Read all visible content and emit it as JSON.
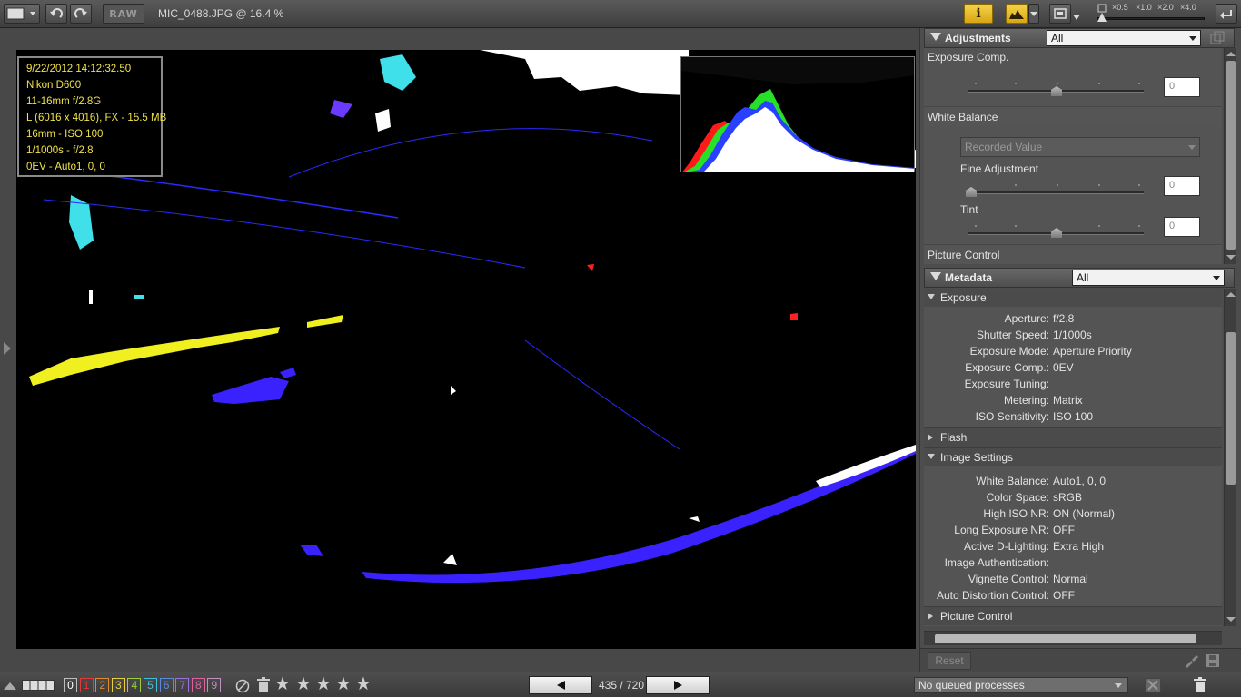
{
  "window": {
    "title": "MIC_0488.JPG @ 16.4 %"
  },
  "toolbar": {
    "raw_label": "RAW",
    "info_label": "i",
    "zoom_levels": [
      "×0.5",
      "×1.0",
      "×2.0",
      "×4.0"
    ]
  },
  "photo_info": {
    "lines": [
      "9/22/2012 14:12:32.50",
      "Nikon D600",
      "11-16mm f/2.8G",
      "L (6016 x 4016), FX - 15.5 MB",
      "16mm - ISO 100",
      "1/1000s - f/2.8",
      "0EV - Auto1, 0, 0"
    ]
  },
  "adjustments": {
    "title": "Adjustments",
    "filter": "All",
    "exposure_comp_label": "Exposure Comp.",
    "exposure_comp_value": "0",
    "white_balance_label": "White Balance",
    "white_balance_preset": "Recorded Value",
    "fine_adjustment_label": "Fine Adjustment",
    "fine_adjustment_value": "0",
    "tint_label": "Tint",
    "tint_value": "0",
    "picture_control_label": "Picture Control"
  },
  "metadata": {
    "title": "Metadata",
    "filter": "All",
    "groups": {
      "exposure": "Exposure",
      "flash": "Flash",
      "image_settings": "Image Settings",
      "picture_control": "Picture Control"
    },
    "exposure_rows": [
      {
        "key": "Aperture:",
        "value": "f/2.8"
      },
      {
        "key": "Shutter Speed:",
        "value": "1/1000s"
      },
      {
        "key": "Exposure Mode:",
        "value": "Aperture Priority"
      },
      {
        "key": "Exposure Comp.:",
        "value": "0EV"
      },
      {
        "key": "Exposure Tuning:",
        "value": ""
      },
      {
        "key": "Metering:",
        "value": "Matrix"
      },
      {
        "key": "ISO Sensitivity:",
        "value": "ISO 100"
      }
    ],
    "image_settings_rows": [
      {
        "key": "White Balance:",
        "value": "Auto1, 0, 0"
      },
      {
        "key": "Color Space:",
        "value": "sRGB"
      },
      {
        "key": "High ISO NR:",
        "value": "ON (Normal)"
      },
      {
        "key": "Long Exposure NR:",
        "value": "OFF"
      },
      {
        "key": "Active D-Lighting:",
        "value": "Extra High"
      },
      {
        "key": "Image Authentication:",
        "value": ""
      },
      {
        "key": "Vignette Control:",
        "value": "Normal"
      },
      {
        "key": "Auto Distortion Control:",
        "value": "OFF"
      }
    ]
  },
  "panel_footer": {
    "reset_label": "Reset"
  },
  "bottombar": {
    "labels": [
      "0",
      "1",
      "2",
      "3",
      "4",
      "5",
      "6",
      "7",
      "8",
      "9"
    ],
    "label_colors": [
      "#bdbdbd",
      "#e23a3a",
      "#e08a2a",
      "#e8d040",
      "#9ad040",
      "#40c0e0",
      "#5a8ae0",
      "#a070e0",
      "#e060a0",
      "#c090c0"
    ],
    "page_counter": "435 / 720",
    "queue_status": "No queued processes"
  },
  "colors": {
    "accent": "#f0c830",
    "info_text": "#f0e24a",
    "panel_bg": "#4d4d4d"
  }
}
